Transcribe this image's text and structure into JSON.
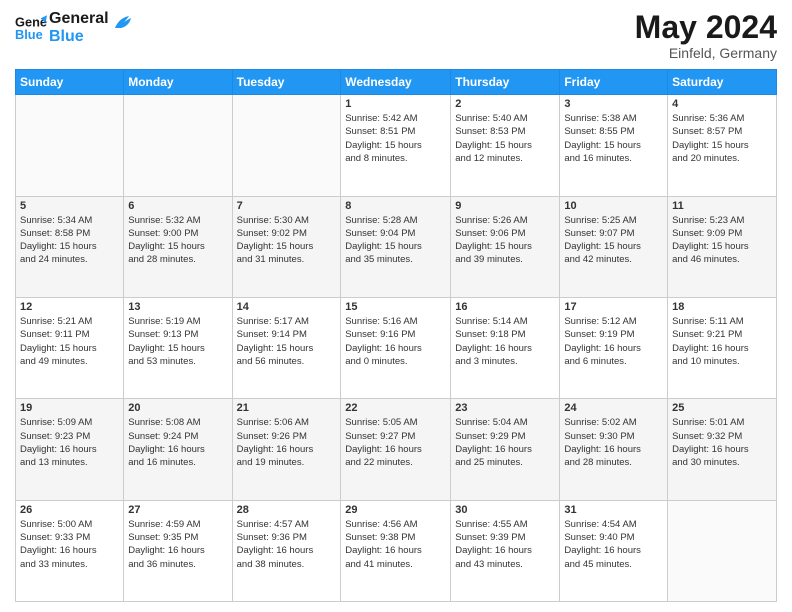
{
  "header": {
    "logo_line1": "General",
    "logo_line2": "Blue",
    "month": "May 2024",
    "location": "Einfeld, Germany"
  },
  "weekdays": [
    "Sunday",
    "Monday",
    "Tuesday",
    "Wednesday",
    "Thursday",
    "Friday",
    "Saturday"
  ],
  "weeks": [
    [
      {
        "day": "",
        "info": ""
      },
      {
        "day": "",
        "info": ""
      },
      {
        "day": "",
        "info": ""
      },
      {
        "day": "1",
        "info": "Sunrise: 5:42 AM\nSunset: 8:51 PM\nDaylight: 15 hours\nand 8 minutes."
      },
      {
        "day": "2",
        "info": "Sunrise: 5:40 AM\nSunset: 8:53 PM\nDaylight: 15 hours\nand 12 minutes."
      },
      {
        "day": "3",
        "info": "Sunrise: 5:38 AM\nSunset: 8:55 PM\nDaylight: 15 hours\nand 16 minutes."
      },
      {
        "day": "4",
        "info": "Sunrise: 5:36 AM\nSunset: 8:57 PM\nDaylight: 15 hours\nand 20 minutes."
      }
    ],
    [
      {
        "day": "5",
        "info": "Sunrise: 5:34 AM\nSunset: 8:58 PM\nDaylight: 15 hours\nand 24 minutes."
      },
      {
        "day": "6",
        "info": "Sunrise: 5:32 AM\nSunset: 9:00 PM\nDaylight: 15 hours\nand 28 minutes."
      },
      {
        "day": "7",
        "info": "Sunrise: 5:30 AM\nSunset: 9:02 PM\nDaylight: 15 hours\nand 31 minutes."
      },
      {
        "day": "8",
        "info": "Sunrise: 5:28 AM\nSunset: 9:04 PM\nDaylight: 15 hours\nand 35 minutes."
      },
      {
        "day": "9",
        "info": "Sunrise: 5:26 AM\nSunset: 9:06 PM\nDaylight: 15 hours\nand 39 minutes."
      },
      {
        "day": "10",
        "info": "Sunrise: 5:25 AM\nSunset: 9:07 PM\nDaylight: 15 hours\nand 42 minutes."
      },
      {
        "day": "11",
        "info": "Sunrise: 5:23 AM\nSunset: 9:09 PM\nDaylight: 15 hours\nand 46 minutes."
      }
    ],
    [
      {
        "day": "12",
        "info": "Sunrise: 5:21 AM\nSunset: 9:11 PM\nDaylight: 15 hours\nand 49 minutes."
      },
      {
        "day": "13",
        "info": "Sunrise: 5:19 AM\nSunset: 9:13 PM\nDaylight: 15 hours\nand 53 minutes."
      },
      {
        "day": "14",
        "info": "Sunrise: 5:17 AM\nSunset: 9:14 PM\nDaylight: 15 hours\nand 56 minutes."
      },
      {
        "day": "15",
        "info": "Sunrise: 5:16 AM\nSunset: 9:16 PM\nDaylight: 16 hours\nand 0 minutes."
      },
      {
        "day": "16",
        "info": "Sunrise: 5:14 AM\nSunset: 9:18 PM\nDaylight: 16 hours\nand 3 minutes."
      },
      {
        "day": "17",
        "info": "Sunrise: 5:12 AM\nSunset: 9:19 PM\nDaylight: 16 hours\nand 6 minutes."
      },
      {
        "day": "18",
        "info": "Sunrise: 5:11 AM\nSunset: 9:21 PM\nDaylight: 16 hours\nand 10 minutes."
      }
    ],
    [
      {
        "day": "19",
        "info": "Sunrise: 5:09 AM\nSunset: 9:23 PM\nDaylight: 16 hours\nand 13 minutes."
      },
      {
        "day": "20",
        "info": "Sunrise: 5:08 AM\nSunset: 9:24 PM\nDaylight: 16 hours\nand 16 minutes."
      },
      {
        "day": "21",
        "info": "Sunrise: 5:06 AM\nSunset: 9:26 PM\nDaylight: 16 hours\nand 19 minutes."
      },
      {
        "day": "22",
        "info": "Sunrise: 5:05 AM\nSunset: 9:27 PM\nDaylight: 16 hours\nand 22 minutes."
      },
      {
        "day": "23",
        "info": "Sunrise: 5:04 AM\nSunset: 9:29 PM\nDaylight: 16 hours\nand 25 minutes."
      },
      {
        "day": "24",
        "info": "Sunrise: 5:02 AM\nSunset: 9:30 PM\nDaylight: 16 hours\nand 28 minutes."
      },
      {
        "day": "25",
        "info": "Sunrise: 5:01 AM\nSunset: 9:32 PM\nDaylight: 16 hours\nand 30 minutes."
      }
    ],
    [
      {
        "day": "26",
        "info": "Sunrise: 5:00 AM\nSunset: 9:33 PM\nDaylight: 16 hours\nand 33 minutes."
      },
      {
        "day": "27",
        "info": "Sunrise: 4:59 AM\nSunset: 9:35 PM\nDaylight: 16 hours\nand 36 minutes."
      },
      {
        "day": "28",
        "info": "Sunrise: 4:57 AM\nSunset: 9:36 PM\nDaylight: 16 hours\nand 38 minutes."
      },
      {
        "day": "29",
        "info": "Sunrise: 4:56 AM\nSunset: 9:38 PM\nDaylight: 16 hours\nand 41 minutes."
      },
      {
        "day": "30",
        "info": "Sunrise: 4:55 AM\nSunset: 9:39 PM\nDaylight: 16 hours\nand 43 minutes."
      },
      {
        "day": "31",
        "info": "Sunrise: 4:54 AM\nSunset: 9:40 PM\nDaylight: 16 hours\nand 45 minutes."
      },
      {
        "day": "",
        "info": ""
      }
    ]
  ]
}
